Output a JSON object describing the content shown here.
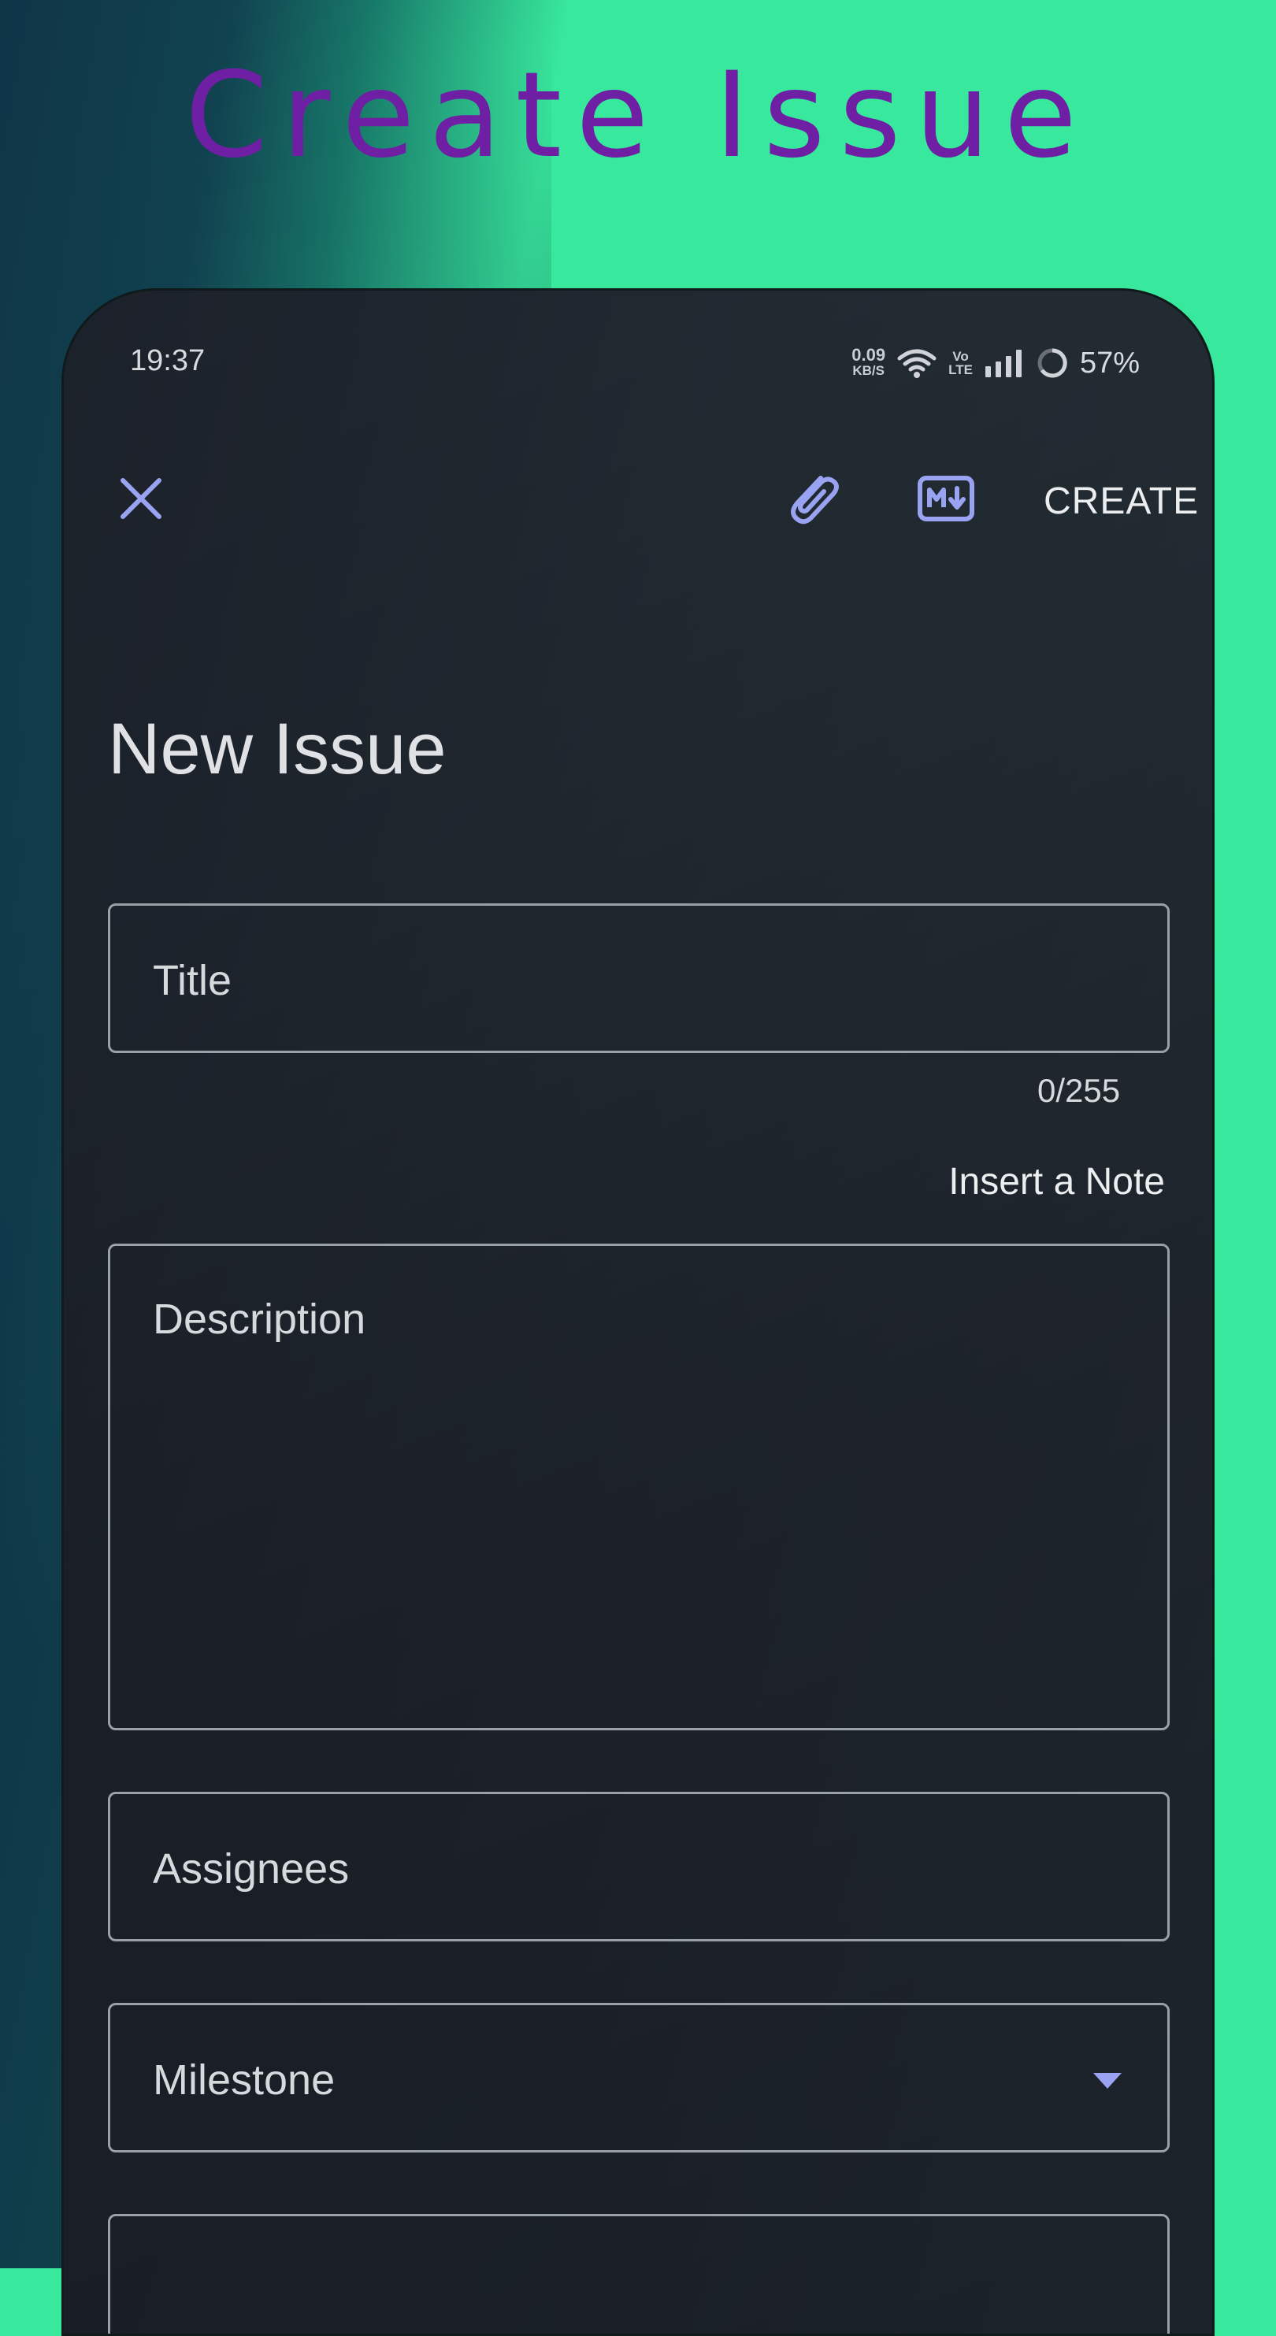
{
  "headline": "Create Issue",
  "status_bar": {
    "time": "19:37",
    "net_speed_value": "0.09",
    "net_speed_unit": "KB/S",
    "volte_top": "Vo",
    "volte_bottom": "LTE",
    "battery": "57%"
  },
  "toolbar": {
    "close_icon": "close-icon",
    "attach_icon": "paperclip-icon",
    "markdown_icon": "markdown-icon",
    "create_label": "CREATE"
  },
  "form": {
    "heading": "New Issue",
    "title_placeholder": "Title",
    "title_counter": "0/255",
    "insert_note_label": "Insert a Note",
    "description_placeholder": "Description",
    "assignees_placeholder": "Assignees",
    "milestone_placeholder": "Milestone"
  },
  "colors": {
    "background": "#38e89c",
    "headline": "#6e1fa3",
    "phone_surface": "#222b32",
    "accent_icon": "#9aa3f2",
    "field_border": "#9aa1a6",
    "text": "#dfe1e4"
  }
}
